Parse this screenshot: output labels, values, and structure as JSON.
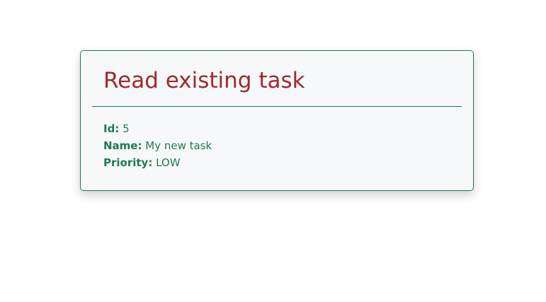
{
  "card": {
    "title": "Read existing task",
    "fields": [
      {
        "label": "Id:",
        "value": "5"
      },
      {
        "label": "Name:",
        "value": "My new task"
      },
      {
        "label": "Priority:",
        "value": "LOW"
      }
    ]
  },
  "colors": {
    "title": "#a02a2a",
    "accent": "#1e7b4f",
    "card_background": "#f7f8fa"
  }
}
